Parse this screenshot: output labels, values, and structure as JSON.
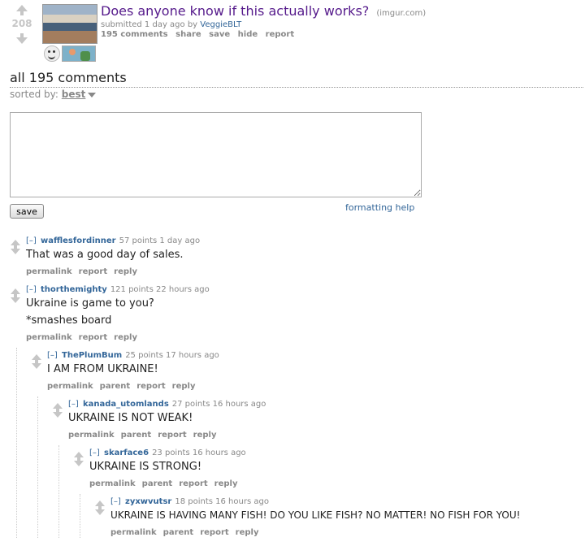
{
  "post": {
    "score": "208",
    "title": "Does anyone know if this actually works?",
    "domain": "(imgur.com)",
    "tagline_prefix": "submitted 1 day ago by",
    "author": "VeggieBLT",
    "buttons": [
      "195 comments",
      "share",
      "save",
      "hide",
      "report"
    ]
  },
  "comments_header": "all 195 comments",
  "sort": {
    "label": "sorted by:",
    "value": "best"
  },
  "reply_form": {
    "save_label": "save",
    "formatting_help": "formatting help"
  },
  "comments": [
    {
      "expand": "[–]",
      "author": "wafflesfordinner",
      "points": "57 points",
      "time": "1 day ago",
      "body": [
        "That was a good day of sales."
      ],
      "links": [
        "permalink",
        "report",
        "reply"
      ]
    },
    {
      "expand": "[–]",
      "author": "thorthemighty",
      "points": "121 points",
      "time": "22 hours ago",
      "body": [
        "Ukraine is game to you?",
        "*smashes board"
      ],
      "links": [
        "permalink",
        "report",
        "reply"
      ]
    },
    {
      "expand": "[–]",
      "author": "ThePlumBum",
      "points": "25 points",
      "time": "17 hours ago",
      "body": [
        "I AM FROM UKRAINE!"
      ],
      "links": [
        "permalink",
        "parent",
        "report",
        "reply"
      ]
    },
    {
      "expand": "[–]",
      "author": "kanada_utomlands",
      "points": "27 points",
      "time": "16 hours ago",
      "body": [
        "UKRAINE IS NOT WEAK!"
      ],
      "links": [
        "permalink",
        "parent",
        "report",
        "reply"
      ]
    },
    {
      "expand": "[–]",
      "author": "skarface6",
      "points": "23 points",
      "time": "16 hours ago",
      "body": [
        "UKRAINE IS STRONG!"
      ],
      "links": [
        "permalink",
        "parent",
        "report",
        "reply"
      ]
    },
    {
      "expand": "[–]",
      "author": "zyxwvutsr",
      "points": "18 points",
      "time": "16 hours ago",
      "body": [
        "UKRAINE IS HAVING MANY FISH! DO YOU LIKE FISH? NO MATTER! NO FISH FOR YOU!"
      ],
      "links": [
        "permalink",
        "parent",
        "report",
        "reply"
      ]
    }
  ]
}
